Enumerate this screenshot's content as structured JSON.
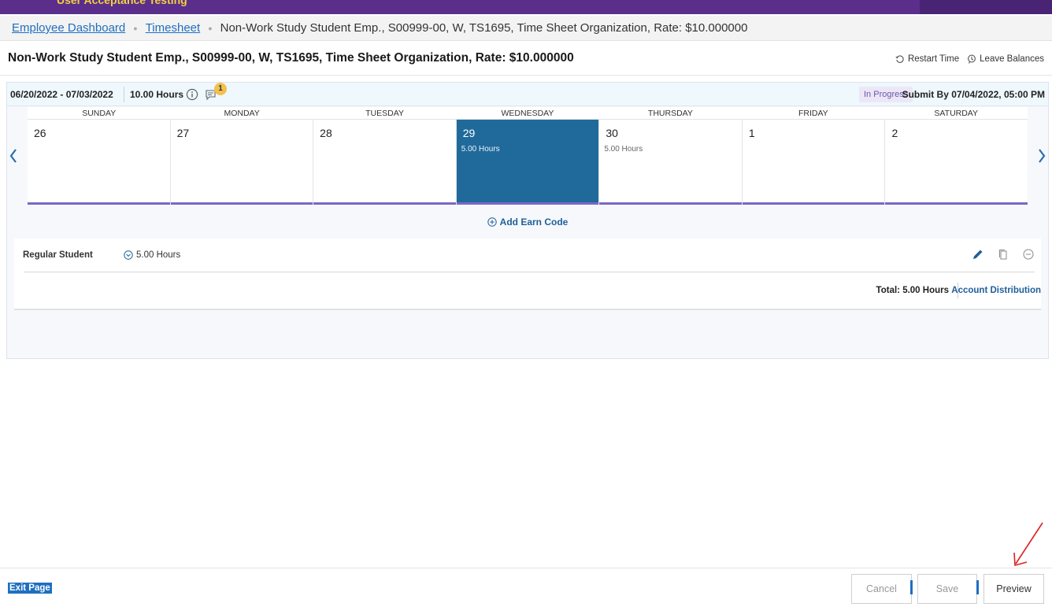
{
  "banner": {
    "env_label": "User Acceptance Testing"
  },
  "breadcrumb": {
    "items": [
      "Employee Dashboard",
      "Timesheet"
    ],
    "current": "Non-Work Study Student Emp., S00999-00, W, TS1695, Time Sheet Organization, Rate: $10.000000"
  },
  "header": {
    "title": "Non-Work Study Student Emp., S00999-00, W, TS1695, Time Sheet Organization, Rate: $10.000000",
    "restart_time": "Restart Time",
    "leave_balances": "Leave Balances"
  },
  "period": {
    "dates": "06/20/2022 - 07/03/2022",
    "hours": "10.00 Hours",
    "comment_count": "1",
    "status": "In Progress",
    "submit_by": "Submit By 07/04/2022, 05:00 PM"
  },
  "calendar": {
    "weekdays": [
      "SUNDAY",
      "MONDAY",
      "TUESDAY",
      "WEDNESDAY",
      "THURSDAY",
      "FRIDAY",
      "SATURDAY"
    ],
    "days": [
      {
        "num": "26",
        "hours": ""
      },
      {
        "num": "27",
        "hours": ""
      },
      {
        "num": "28",
        "hours": ""
      },
      {
        "num": "29",
        "hours": "5.00 Hours"
      },
      {
        "num": "30",
        "hours": "5.00 Hours"
      },
      {
        "num": "1",
        "hours": ""
      },
      {
        "num": "2",
        "hours": ""
      }
    ],
    "selected_day": "29"
  },
  "earn": {
    "add_label": "Add Earn Code",
    "name": "Regular Student",
    "hours": "5.00 Hours",
    "total": "Total: 5.00 Hours",
    "account_distribution": "Account Distribution"
  },
  "footer": {
    "exit_page": "Exit Page",
    "cancel": "Cancel",
    "save": "Save",
    "preview": "Preview"
  },
  "colors": {
    "banner": "#5b2e8c",
    "selected_day": "#1f6a9b",
    "link": "#1f6fc0",
    "day_bar": "#7b68c6",
    "annotation_arrow": "#e02020"
  }
}
